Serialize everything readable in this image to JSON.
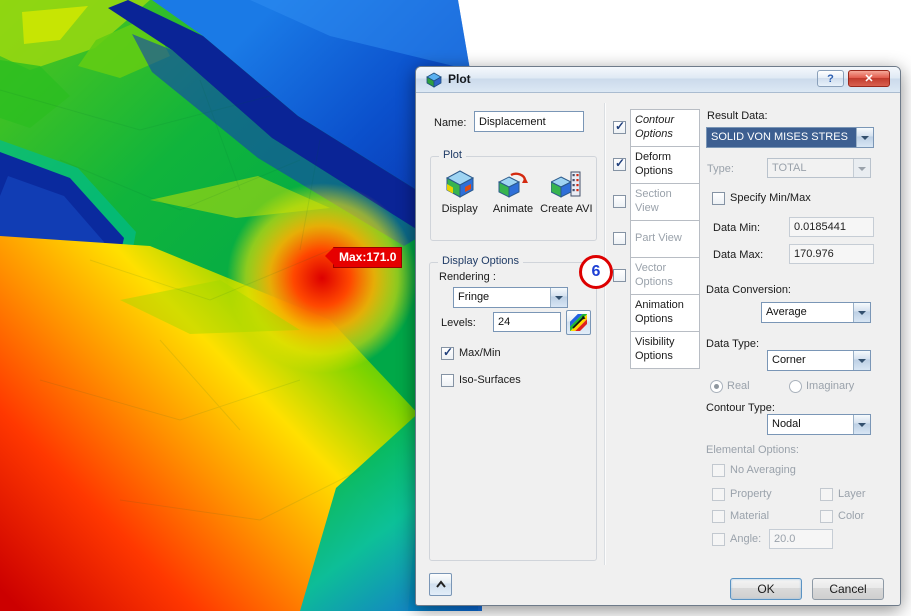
{
  "window": {
    "title": "Plot",
    "help_glyph": "?",
    "close_glyph": "✕"
  },
  "canvas": {
    "max_tag": "Max:171.0"
  },
  "callout": {
    "number": "6"
  },
  "name_row": {
    "label": "Name:",
    "value": "Displacement"
  },
  "plot_group": {
    "title": "Plot",
    "actions": [
      {
        "label": "Display"
      },
      {
        "label": "Animate"
      },
      {
        "label": "Create AVI"
      }
    ]
  },
  "display_options": {
    "title": "Display Options",
    "rendering_label": "Rendering :",
    "rendering_value": "Fringe",
    "levels_label": "Levels:",
    "levels_value": "24",
    "max_min_label": "Max/Min",
    "iso_surfaces_label": "Iso-Surfaces"
  },
  "option_tabs": [
    {
      "label": "Contour Options",
      "checked": true,
      "selected": true,
      "disabled": false
    },
    {
      "label": "Deform Options",
      "checked": true,
      "selected": false,
      "disabled": false
    },
    {
      "label": "Section View",
      "checked": false,
      "selected": false,
      "disabled": true
    },
    {
      "label": "Part View",
      "checked": false,
      "selected": false,
      "disabled": true
    },
    {
      "label": "Vector Options",
      "checked": false,
      "selected": false,
      "disabled": true
    },
    {
      "label": "Animation Options",
      "checked": null,
      "selected": false,
      "disabled": false
    },
    {
      "label": "Visibility Options",
      "checked": null,
      "selected": false,
      "disabled": false
    }
  ],
  "contour_panel": {
    "result_data_label": "Result Data:",
    "result_value": "SOLID VON MISES STRES",
    "type_label": "Type:",
    "type_value": "TOTAL",
    "specify_label": "Specify Min/Max",
    "data_min_label": "Data Min:",
    "data_min_value": "0.0185441",
    "data_max_label": "Data Max:",
    "data_max_value": "170.976",
    "data_conversion_label": "Data Conversion:",
    "data_conversion_value": "Average",
    "data_type_label": "Data Type:",
    "data_type_value": "Corner",
    "real_label": "Real",
    "imaginary_label": "Imaginary",
    "contour_type_label": "Contour Type:",
    "contour_type_value": "Nodal",
    "elemental_label": "Elemental Options:",
    "no_averaging_label": "No Averaging",
    "property_label": "Property",
    "layer_label": "Layer",
    "material_label": "Material",
    "color_label": "Color",
    "angle_label": "Angle:",
    "angle_value": "20.0"
  },
  "footer": {
    "ok": "OK",
    "cancel": "Cancel"
  },
  "colors": {
    "annotation_red": "#dd0000",
    "annotation_blue": "#1d3fd4",
    "selection": "#3d5f91",
    "max_flag": "#e60000"
  }
}
